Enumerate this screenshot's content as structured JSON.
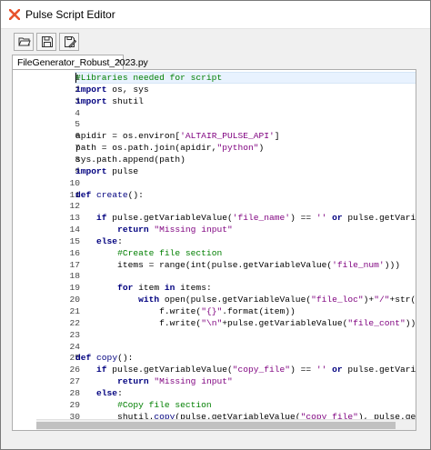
{
  "window": {
    "title": "Pulse Script Editor",
    "brand_color": "#e8532d"
  },
  "toolbar": {
    "buttons": [
      {
        "name": "open-file-button",
        "icon": "folder-open-icon"
      },
      {
        "name": "save-button",
        "icon": "floppy-disk-icon"
      },
      {
        "name": "save-as-button",
        "icon": "save-as-icon"
      }
    ]
  },
  "tabs": [
    {
      "label": "FileGenerator_Robust_2023.py",
      "close": "×"
    }
  ],
  "editor": {
    "language": "python",
    "lines": [
      {
        "n": "1",
        "text": "#Libraries needed for script"
      },
      {
        "n": "2",
        "text": "import os, sys"
      },
      {
        "n": "3",
        "text": "import shutil"
      },
      {
        "n": "4",
        "text": ""
      },
      {
        "n": "5",
        "text": ""
      },
      {
        "n": "6",
        "text": "apidir = os.environ['ALTAIR_PULSE_API']"
      },
      {
        "n": "7",
        "text": "path = os.path.join(apidir,\"python\")"
      },
      {
        "n": "8",
        "text": "sys.path.append(path)"
      },
      {
        "n": "9",
        "text": "import pulse"
      },
      {
        "n": "10",
        "text": ""
      },
      {
        "n": "11",
        "text": "def create():"
      },
      {
        "n": "12",
        "text": ""
      },
      {
        "n": "13",
        "text": "    if pulse.getVariableValue('file_name') == '' or pulse.getVariabl"
      },
      {
        "n": "14",
        "text": "        return \"Missing input\""
      },
      {
        "n": "15",
        "text": "    else:"
      },
      {
        "n": "16",
        "text": "        #Create file section"
      },
      {
        "n": "17",
        "text": "        items = range(int(pulse.getVariableValue('file_num')))"
      },
      {
        "n": "18",
        "text": ""
      },
      {
        "n": "19",
        "text": "        for item in items:"
      },
      {
        "n": "20",
        "text": "            with open(pulse.getVariableValue(\"file_loc\")+\"/\"+str(ite"
      },
      {
        "n": "21",
        "text": "                f.write(\"{}\".format(item))"
      },
      {
        "n": "22",
        "text": "                f.write(\"\\n\"+pulse.getVariableValue(\"file_cont\"))"
      },
      {
        "n": "23",
        "text": ""
      },
      {
        "n": "24",
        "text": ""
      },
      {
        "n": "25",
        "text": "def copy():"
      },
      {
        "n": "26",
        "text": "    if pulse.getVariableValue(\"copy_file\") == '' or pulse.getVariab"
      },
      {
        "n": "27",
        "text": "        return \"Missing input\""
      },
      {
        "n": "28",
        "text": "    else:"
      },
      {
        "n": "29",
        "text": "        #Copy file section"
      },
      {
        "n": "30",
        "text": "        shutil.copy(pulse.getVariableValue(\"copy file\"), pulse.getVa"
      }
    ]
  },
  "colors": {
    "keyword": "#00007f",
    "string": "#7f007f",
    "comment": "#007f00",
    "current_line": "#e8f2fe"
  }
}
